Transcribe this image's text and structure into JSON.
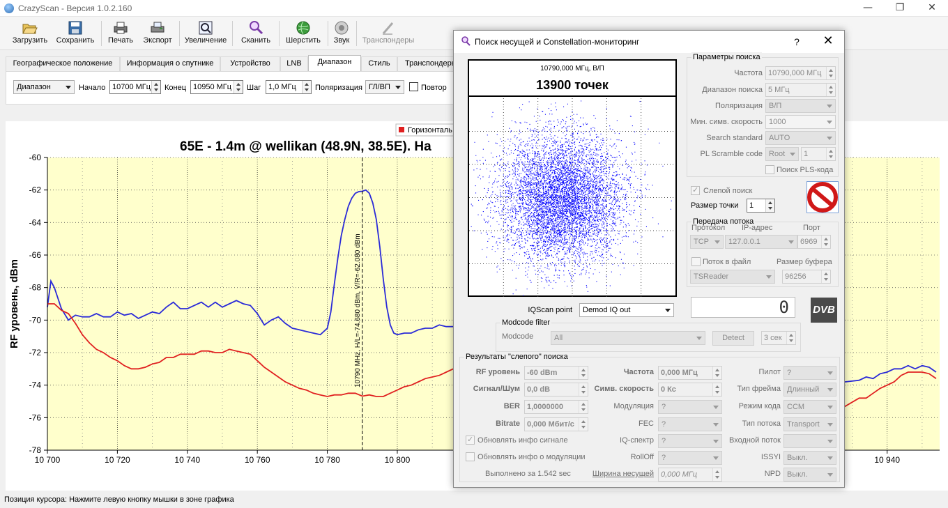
{
  "window": {
    "title": "CrazyScan - Версия 1.0.2.160",
    "minimize": "—",
    "maximize": "❐",
    "close": "✕"
  },
  "toolbar": [
    {
      "label": "Загрузить",
      "icon": "folder-open-icon",
      "enabled": true
    },
    {
      "label": "Сохранить",
      "icon": "floppy-disk-icon",
      "enabled": true
    },
    {
      "label": "Печать",
      "icon": "printer-icon",
      "enabled": true
    },
    {
      "label": "Экспорт",
      "icon": "export-printer-icon",
      "enabled": true
    },
    {
      "label": "Увеличение",
      "icon": "zoom-icon",
      "enabled": true
    },
    {
      "label": "Сканить",
      "icon": "scan-magnifier-icon",
      "enabled": true
    },
    {
      "label": "Шерстить",
      "icon": "globe-icon",
      "enabled": true
    },
    {
      "label": "Звук",
      "icon": "speaker-icon",
      "enabled": true
    },
    {
      "label": "Транспондеры",
      "icon": "transponders-icon",
      "enabled": false
    }
  ],
  "tabs": [
    {
      "label": "Географическое положение",
      "active": false
    },
    {
      "label": "Информация о спутнике",
      "active": false
    },
    {
      "label": "Устройство",
      "active": false
    },
    {
      "label": "LNB",
      "active": false
    },
    {
      "label": "Диапазон",
      "active": true
    },
    {
      "label": "Стиль",
      "active": false
    },
    {
      "label": "Транспондеры",
      "active": false
    }
  ],
  "range_panel": {
    "mode": "Диапазон",
    "start_label": "Начало",
    "start_value": "10700 МГц",
    "end_label": "Конец",
    "end_value": "10950 МГц",
    "step_label": "Шаг",
    "step_value": "1,0 МГц",
    "polarization_label": "Поляризация",
    "polarization_value": "ГЛ/ВП",
    "repeat_label": "Повтор"
  },
  "chart_data": {
    "type": "line",
    "title": "65E - 1.4m @ wellikan (48.9N, 38.5E). Ha",
    "ylabel": "RF уровень, dBm",
    "xlabel": "",
    "xlim": [
      10700,
      10955
    ],
    "ylim": [
      -78,
      -60
    ],
    "xticks": [
      10700,
      10720,
      10740,
      10760,
      10780,
      10800,
      10940
    ],
    "xtick_labels": [
      "10 700",
      "10 720",
      "10 740",
      "10 760",
      "10 780",
      "10 800",
      "10 940"
    ],
    "yticks": [
      -60,
      -62,
      -64,
      -66,
      -68,
      -70,
      -72,
      -74,
      -76,
      -78
    ],
    "legend_label": "Горизонталь",
    "cursor_annotation": "10790 MHz, H/L=-74.680 dBm, V/R=-62.080 dBm",
    "cursor_x": 10790,
    "series": [
      {
        "name": "",
        "color": "#2a2ad8",
        "x": [
          10700,
          10701,
          10702,
          10704,
          10706,
          10708,
          10710,
          10712,
          10714,
          10716,
          10718,
          10720,
          10722,
          10724,
          10726,
          10728,
          10730,
          10732,
          10734,
          10736,
          10738,
          10740,
          10742,
          10744,
          10746,
          10748,
          10750,
          10752,
          10754,
          10756,
          10758,
          10760,
          10762,
          10764,
          10766,
          10768,
          10770,
          10772,
          10774,
          10776,
          10778,
          10780,
          10781,
          10782,
          10783,
          10784,
          10785,
          10786,
          10787,
          10788,
          10789,
          10790,
          10791,
          10792,
          10793,
          10794,
          10795,
          10796,
          10797,
          10798,
          10799,
          10800,
          10802,
          10804,
          10806,
          10808,
          10810,
          10812,
          10814,
          10816
        ],
        "y": [
          -69.2,
          -67.6,
          -68,
          -69.3,
          -70,
          -69.7,
          -69.8,
          -69.8,
          -69.6,
          -69.8,
          -69.8,
          -69.5,
          -69.7,
          -69.6,
          -69.9,
          -69.7,
          -69.5,
          -69.6,
          -69.2,
          -68.9,
          -69.3,
          -69.3,
          -69.1,
          -68.9,
          -69.2,
          -68.9,
          -69.2,
          -69,
          -68.8,
          -69,
          -69.1,
          -69.6,
          -70.3,
          -70,
          -69.8,
          -70.2,
          -70.5,
          -70.6,
          -70.7,
          -70.8,
          -70.9,
          -70.5,
          -69.5,
          -67.8,
          -66.2,
          -64.8,
          -63.8,
          -63,
          -62.5,
          -62.2,
          -62.1,
          -62.08,
          -62,
          -62.2,
          -62.8,
          -63.8,
          -65.5,
          -67.5,
          -69.2,
          -70.3,
          -70.8,
          -70.9,
          -70.8,
          -70.8,
          -70.6,
          -70.5,
          -70.5,
          -70.3,
          -70.4,
          -70.4
        ]
      },
      {
        "name": "",
        "color": "#e02020",
        "x": [
          10700,
          10702,
          10704,
          10706,
          10708,
          10710,
          10712,
          10714,
          10716,
          10718,
          10720,
          10722,
          10724,
          10726,
          10728,
          10730,
          10732,
          10734,
          10736,
          10738,
          10740,
          10742,
          10744,
          10746,
          10748,
          10750,
          10752,
          10754,
          10756,
          10758,
          10760,
          10762,
          10764,
          10766,
          10768,
          10770,
          10772,
          10774,
          10776,
          10778,
          10780,
          10782,
          10784,
          10786,
          10788,
          10790,
          10792,
          10794,
          10796,
          10798,
          10800,
          10802,
          10804,
          10806,
          10808,
          10810,
          10812,
          10814,
          10816
        ],
        "y": [
          -69,
          -69,
          -69.4,
          -69.6,
          -70.2,
          -70.9,
          -71.4,
          -71.8,
          -72,
          -72.3,
          -72.5,
          -72.8,
          -73,
          -73,
          -72.9,
          -72.7,
          -72.6,
          -72.3,
          -72.3,
          -72.1,
          -72.1,
          -72.1,
          -71.9,
          -71.9,
          -72,
          -72,
          -71.8,
          -71.9,
          -72,
          -72.1,
          -72.5,
          -72.9,
          -73.2,
          -73.5,
          -73.8,
          -74,
          -74.2,
          -74.3,
          -74.5,
          -74.6,
          -74.7,
          -74.6,
          -74.6,
          -74.5,
          -74.5,
          -74.68,
          -74.6,
          -74.7,
          -74.7,
          -74.5,
          -74.3,
          -74.1,
          -74,
          -73.8,
          -73.6,
          -73.5,
          -73.4,
          -73.2,
          -73
        ]
      },
      {
        "name": "",
        "color": "#2a2ad8",
        "x": [
          10920,
          10924,
          10928,
          10932,
          10934,
          10936,
          10938,
          10940,
          10942,
          10944,
          10946,
          10948,
          10950,
          10952,
          10954
        ],
        "y": [
          -73.8,
          -73.8,
          -73.8,
          -73.7,
          -73.5,
          -73.6,
          -73.3,
          -73.2,
          -73,
          -73,
          -72.8,
          -73,
          -72.8,
          -72.9,
          -73.2
        ]
      },
      {
        "name": "",
        "color": "#e02020",
        "x": [
          10920,
          10924,
          10928,
          10932,
          10934,
          10936,
          10938,
          10940,
          10942,
          10944,
          10946,
          10948,
          10950,
          10952,
          10954
        ],
        "y": [
          -76,
          -75.6,
          -75.3,
          -74.8,
          -74.8,
          -74.5,
          -74.2,
          -74,
          -73.8,
          -73.4,
          -73.2,
          -73.2,
          -73.2,
          -73.3,
          -73.6
        ]
      }
    ]
  },
  "statusbar": {
    "text": "Позиция курсора: Нажмите левую кнопку мышки в зоне графика"
  },
  "dialog": {
    "title": "Поиск несущей и Constellation-мониторинг",
    "help": "?",
    "close": "✕",
    "constellation": {
      "freq_label": "10790,000 МГц, В/П",
      "points_label": "13900 точек",
      "dot_color": "#0000ff"
    },
    "search_params": {
      "title": "Параметры поиска",
      "freq_label": "Частота",
      "freq_value": "10790,000 МГц",
      "range_label": "Диапазон поиска",
      "range_value": "5 МГц",
      "pol_label": "Поляризация",
      "pol_value": "В/П",
      "minsym_label": "Мин. симв. скорость",
      "minsym_value": "1000",
      "std_label": "Search standard",
      "std_value": "AUTO",
      "pls_label": "PL Scramble code",
      "pls_mode": "Root",
      "pls_value": "1",
      "pls_search_label": "Поиск PLS-кода"
    },
    "blind_search_label": "Слепой поиск",
    "point_size_label": "Размер точки",
    "point_size_value": "1",
    "stream": {
      "title": "Передача потока",
      "protocol_label": "Протокол",
      "protocol_value": "TCP",
      "ip_label": "IP-адрес",
      "ip_value": "127.0.0.1",
      "port_label": "Порт",
      "port_value": "6969",
      "tofile_label": "Поток в файл",
      "bufsize_label": "Размер буфера",
      "bufsize_value": "96256",
      "player_value": "TSReader"
    },
    "iqscan_label": "IQScan point",
    "iqscan_value": "Demod IQ out",
    "counter_value": "0",
    "dvb_logo": "DVB",
    "modcode": {
      "title": "Modcode filter",
      "label": "Modcode",
      "value": "All",
      "detect_label": "Detect",
      "time_value": "3 сек"
    },
    "results": {
      "title": "Результаты \"слепого\" поиска",
      "rf_label": "RF уровень",
      "rf_value": "-60 dBm",
      "snr_label": "Сигнал/Шум",
      "snr_value": "0,0 dB",
      "ber_label": "BER",
      "ber_value": "1,0000000",
      "bitrate_label": "Bitrate",
      "bitrate_value": "0,000 Мбит/с",
      "freq_label": "Частота",
      "freq_value": "0,000 МГц",
      "sr_label": "Симв. скорость",
      "sr_value": "0 Кс",
      "mod_label": "Модуляция",
      "mod_value": "?",
      "fec_label": "FEC",
      "fec_value": "?",
      "iq_label": "IQ-спектр",
      "iq_value": "?",
      "rolloff_label": "RollOff",
      "rolloff_value": "?",
      "pilot_label": "Пилот",
      "pilot_value": "?",
      "frame_label": "Тип фрейма",
      "frame_value": "Длинный",
      "codemode_label": "Режим кода",
      "codemode_value": "CCM",
      "streamtype_label": "Тип потока",
      "streamtype_value": "Transport",
      "instream_label": "Входной поток",
      "instream_value": "",
      "issyi_label": "ISSYI",
      "issyi_value": "Выкл.",
      "npd_label": "NPD",
      "npd_value": "Выкл.",
      "upd_signal_label": "Обновлять инфо сигнале",
      "upd_mod_label": "Обновлять инфо о модуляции",
      "done_label": "Выполнено за 1.542 sec",
      "carrier_width_label": "Ширина несущей",
      "carrier_width_value": "0,000 МГц"
    }
  }
}
